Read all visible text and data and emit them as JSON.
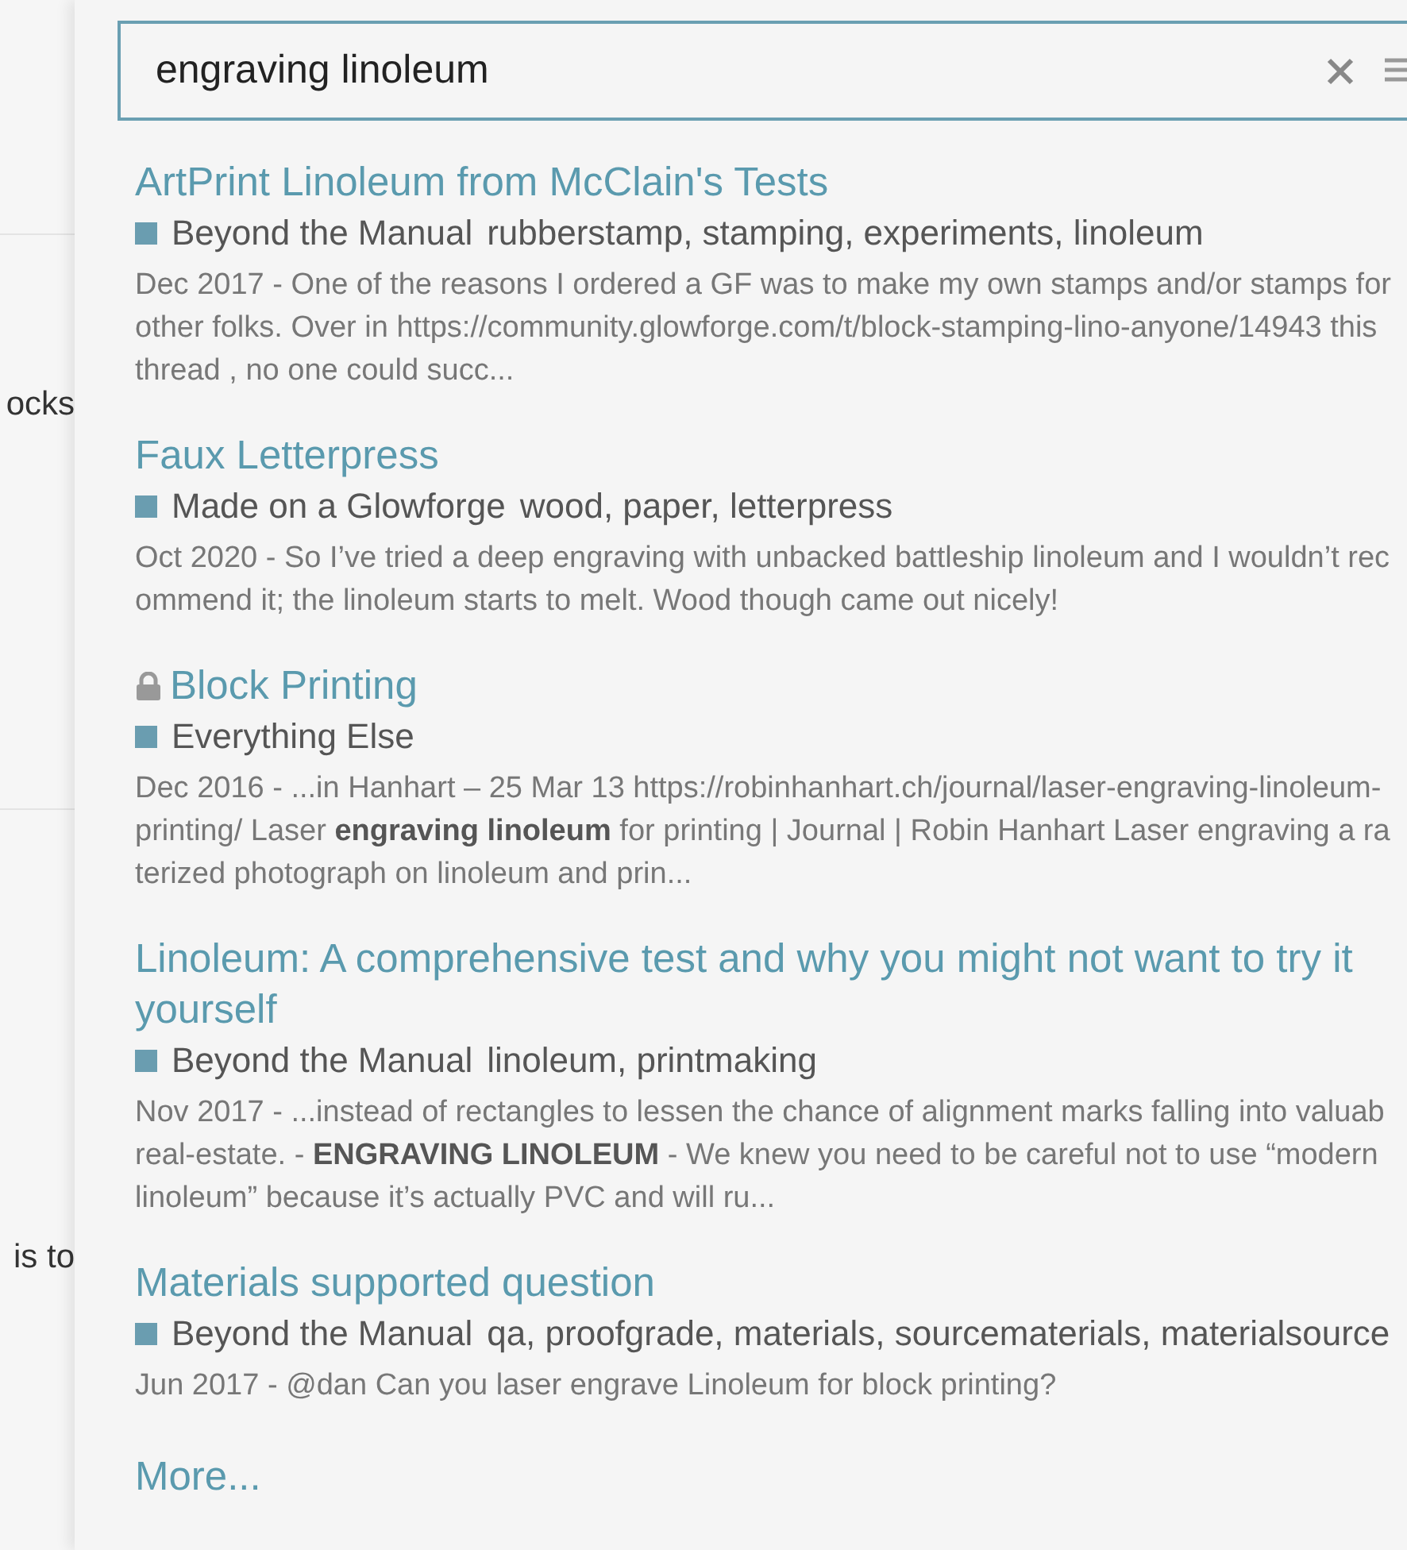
{
  "background": {
    "texts": [
      "ocks",
      "is to"
    ]
  },
  "search": {
    "value": "engraving linoleum"
  },
  "results": [
    {
      "title": "ArtPrint Linoleum from McClain's Tests",
      "locked": false,
      "category": "Beyond the Manual",
      "tags": "rubberstamp, stamping, experiments, linoleum",
      "excerpt": [
        "Dec 2017 - One of the reasons I ordered a GF was to make my own stamps and/or stamps for",
        "other folks. Over in https://community.glowforge.com/t/block-stamping-lino-anyone/14943 this",
        "thread , no one could succ..."
      ]
    },
    {
      "title": "Faux Letterpress",
      "locked": false,
      "category": "Made on a Glowforge",
      "tags": "wood, paper, letterpress",
      "excerpt": [
        "Oct 2020 - So I’ve tried a deep engraving with unbacked battleship linoleum and I wouldn’t rec",
        "ommend it; the linoleum starts to melt. Wood though came out nicely!"
      ]
    },
    {
      "title": "Block Printing",
      "locked": true,
      "category": "Everything Else",
      "excerpt": [
        "Dec 2016 - ...in Hanhart – 25 Mar 13 https://robinhanhart.ch/journal/laser-engraving-linoleum-",
        "printing/ Laser **engraving linoleum** for printing | Journal | Robin Hanhart Laser engraving a ra",
        "terized photograph on linoleum and prin..."
      ]
    },
    {
      "title": "Linoleum: A comprehensive test and why you might not want to try it yourself",
      "locked": false,
      "category": "Beyond the Manual",
      "tags": "linoleum, printmaking",
      "excerpt": [
        "Nov 2017 - ...instead of rectangles to lessen the chance of alignment marks falling into valuab",
        "real-estate. - **ENGRAVING LINOLEUM** - We knew you need to be careful not to use “modern",
        "linoleum” because it’s actually PVC and will ru..."
      ]
    },
    {
      "title": "Materials supported question",
      "locked": false,
      "category": "Beyond the Manual",
      "tags": "qa, proofgrade, materials, sourcematerials, materialsource",
      "excerpt": [
        "Jun 2017 - @dan Can you laser engrave Linoleum for block printing?"
      ]
    }
  ],
  "more_link": "More..."
}
